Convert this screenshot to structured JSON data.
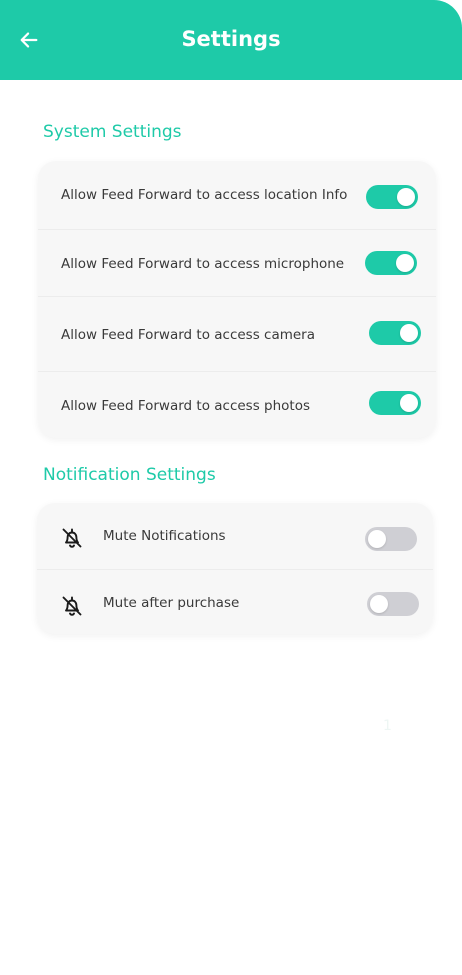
{
  "header": {
    "title": "Settings",
    "back_icon": "arrow-left-icon",
    "color": "#1ecaa8"
  },
  "system_settings": {
    "title": "System Settings",
    "items": [
      {
        "label": "Allow Feed Forward to access location Info",
        "enabled": true
      },
      {
        "label": "Allow Feed Forward to access microphone",
        "enabled": true
      },
      {
        "label": "Allow Feed Forward to access camera",
        "enabled": true
      },
      {
        "label": "Allow Feed Forward to access photos",
        "enabled": true
      }
    ]
  },
  "notification_settings": {
    "title": "Notification Settings",
    "items": [
      {
        "label": "Mute Notifications",
        "icon": "bell-off-icon",
        "enabled": false
      },
      {
        "label": "Mute after purchase",
        "icon": "bell-off-icon",
        "enabled": false
      }
    ]
  },
  "page_indicator": "1"
}
